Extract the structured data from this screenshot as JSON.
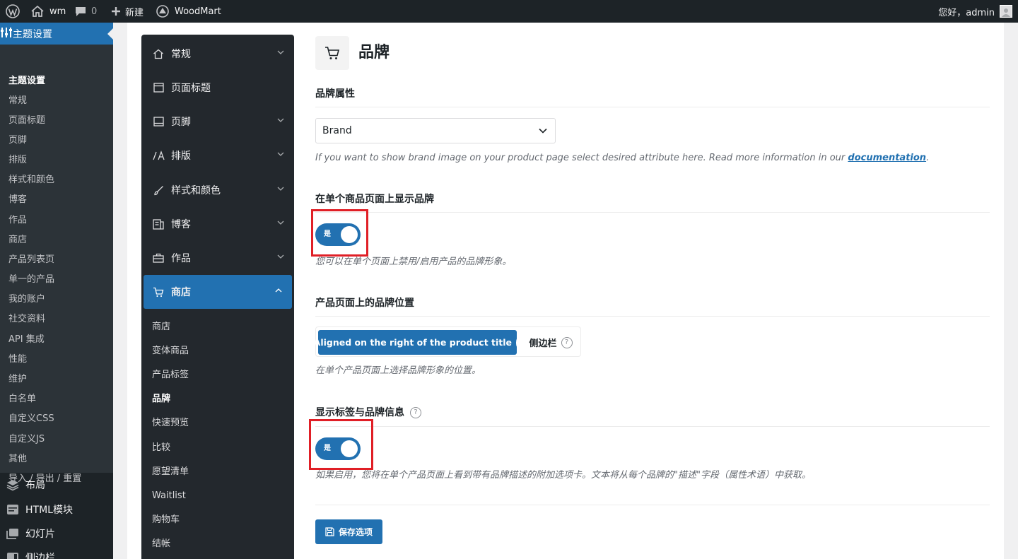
{
  "adminbar": {
    "site_name": "wm",
    "comments_count": "0",
    "new_label": "新建",
    "woodmart_label": "WoodMart",
    "greeting": "您好，admin"
  },
  "adminmenu": {
    "current_label": "主题设置",
    "submenu": [
      "主题设置",
      "常规",
      "页面标题",
      "页脚",
      "排版",
      "样式和颜色",
      "博客",
      "作品",
      "商店",
      "产品列表页",
      "单一的产品",
      "我的账户",
      "社交资料",
      "API 集成",
      "性能",
      "维护",
      "白名单",
      "自定义CSS",
      "自定义JS",
      "其他",
      "导入 / 导出 / 重置"
    ],
    "toplevel": [
      "布局",
      "HTML模块",
      "幻灯片",
      "侧边栏"
    ]
  },
  "optnav": {
    "items": [
      "常规",
      "页面标题",
      "页脚",
      "排版",
      "样式和颜色",
      "博客",
      "作品",
      "商店"
    ],
    "shop_subitems": [
      "商店",
      "变体商品",
      "产品标签",
      "品牌",
      "快速预览",
      "比较",
      "愿望清单",
      "Waitlist",
      "购物车",
      "结帐"
    ]
  },
  "main": {
    "title": "品牌",
    "brand_attr": {
      "title": "品牌属性",
      "selected": "Brand",
      "desc_before": "If you want to show brand image on your product page select desired attribute here. Read more information in our ",
      "desc_link": "documentation",
      "desc_after": "."
    },
    "show_brand": {
      "title": "在单个商品页面上显示品牌",
      "toggle_label": "是",
      "desc": "您可以在单个页面上禁用/启用产品的品牌形象。"
    },
    "brand_position": {
      "title": "产品页面上的品牌位置",
      "option_active": "Aligned on the right of the product title",
      "option_other": "侧边栏",
      "qmark": "?",
      "desc": "在单个产品页面上选择品牌形象的位置。"
    },
    "brand_tab": {
      "title": "显示标签与品牌信息",
      "qmark": "?",
      "toggle_label": "是",
      "desc": "如果启用，您将在单个产品页面上看到带有品牌描述的附加选项卡。文本将从每个品牌的\"描述\"字段（属性术语）中获取。"
    },
    "save_label": "保存选项"
  },
  "colors": {
    "accent": "#2271b1",
    "admin_dark": "#1d2327",
    "highlight_red": "#e01f26"
  }
}
